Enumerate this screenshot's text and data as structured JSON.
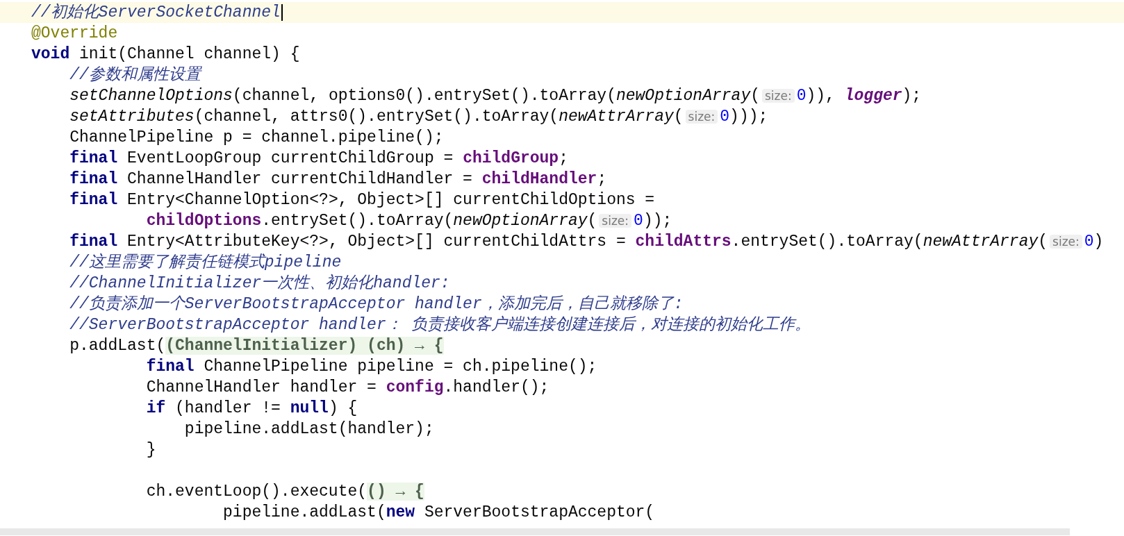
{
  "editor": {
    "lines": [
      {
        "current": true,
        "tokens": [
          {
            "kind": "comment",
            "text": "//初始化ServerSocketChannel"
          }
        ]
      },
      {
        "current": false,
        "tokens": [
          {
            "kind": "annotation",
            "text": "@Override"
          }
        ]
      },
      {
        "current": false,
        "tokens": [
          {
            "kind": "keyword",
            "text": "void"
          },
          {
            "kind": "plain",
            "text": " init(Channel channel) {"
          }
        ]
      },
      {
        "current": false,
        "tokens": [
          {
            "kind": "comment",
            "text": "    //参数和属性设置"
          }
        ]
      },
      {
        "current": false,
        "tokens": [
          {
            "kind": "italic",
            "text": "    setChannelOptions"
          },
          {
            "kind": "plain",
            "text": "(channel, options0().entrySet().toArray("
          },
          {
            "kind": "italic",
            "text": "newOptionArray"
          },
          {
            "kind": "plain",
            "text": "("
          },
          {
            "kind": "hint",
            "text": "size:"
          },
          {
            "kind": "number",
            "text": "0"
          },
          {
            "kind": "plain",
            "text": ")), "
          },
          {
            "kind": "field_italic",
            "text": "logger"
          },
          {
            "kind": "plain",
            "text": ");"
          }
        ]
      },
      {
        "current": false,
        "tokens": [
          {
            "kind": "italic",
            "text": "    setAttributes"
          },
          {
            "kind": "plain",
            "text": "(channel, attrs0().entrySet().toArray("
          },
          {
            "kind": "italic",
            "text": "newAttrArray"
          },
          {
            "kind": "plain",
            "text": "("
          },
          {
            "kind": "hint",
            "text": "size:"
          },
          {
            "kind": "number",
            "text": "0"
          },
          {
            "kind": "plain",
            "text": ")));"
          }
        ]
      },
      {
        "current": false,
        "tokens": [
          {
            "kind": "plain",
            "text": "    ChannelPipeline p = channel.pipeline();"
          }
        ]
      },
      {
        "current": false,
        "tokens": [
          {
            "kind": "keyword",
            "text": "    final"
          },
          {
            "kind": "plain",
            "text": " EventLoopGroup currentChildGroup = "
          },
          {
            "kind": "field",
            "text": "childGroup"
          },
          {
            "kind": "plain",
            "text": ";"
          }
        ]
      },
      {
        "current": false,
        "tokens": [
          {
            "kind": "keyword",
            "text": "    final"
          },
          {
            "kind": "plain",
            "text": " ChannelHandler currentChildHandler = "
          },
          {
            "kind": "field",
            "text": "childHandler"
          },
          {
            "kind": "plain",
            "text": ";"
          }
        ]
      },
      {
        "current": false,
        "tokens": [
          {
            "kind": "keyword",
            "text": "    final"
          },
          {
            "kind": "plain",
            "text": " Entry<ChannelOption<?>, Object>[] currentChildOptions ="
          }
        ]
      },
      {
        "current": false,
        "tokens": [
          {
            "kind": "field",
            "text": "            childOptions"
          },
          {
            "kind": "plain",
            "text": ".entrySet().toArray("
          },
          {
            "kind": "italic",
            "text": "newOptionArray"
          },
          {
            "kind": "plain",
            "text": "("
          },
          {
            "kind": "hint",
            "text": "size:"
          },
          {
            "kind": "number",
            "text": "0"
          },
          {
            "kind": "plain",
            "text": "));"
          }
        ]
      },
      {
        "current": false,
        "tokens": [
          {
            "kind": "keyword",
            "text": "    final"
          },
          {
            "kind": "plain",
            "text": " Entry<AttributeKey<?>, Object>[] currentChildAttrs = "
          },
          {
            "kind": "field",
            "text": "childAttrs"
          },
          {
            "kind": "plain",
            "text": ".entrySet().toArray("
          },
          {
            "kind": "italic",
            "text": "newAttrArray"
          },
          {
            "kind": "plain",
            "text": "("
          },
          {
            "kind": "hint",
            "text": "size:"
          },
          {
            "kind": "number",
            "text": "0"
          },
          {
            "kind": "plain",
            "text": ")"
          }
        ]
      },
      {
        "current": false,
        "tokens": [
          {
            "kind": "comment",
            "text": "    //这里需要了解责任链模式pipeline"
          }
        ]
      },
      {
        "current": false,
        "tokens": [
          {
            "kind": "comment",
            "text": "    //ChannelInitializer一次性、初始化handler:"
          }
        ]
      },
      {
        "current": false,
        "tokens": [
          {
            "kind": "comment",
            "text": "    //负责添加一个ServerBootstrapAcceptor handler，添加完后，自己就移除了:"
          }
        ]
      },
      {
        "current": false,
        "tokens": [
          {
            "kind": "comment",
            "text": "    //ServerBootstrapAcceptor handler： 负责接收客户端连接创建连接后，对连接的初始化工作。"
          }
        ]
      },
      {
        "current": false,
        "tokens": [
          {
            "kind": "plain",
            "text": "    p.addLast("
          },
          {
            "kind": "lambda",
            "text": "(ChannelInitializer) (ch) → {"
          }
        ]
      },
      {
        "current": false,
        "tokens": [
          {
            "kind": "keyword",
            "text": "            final"
          },
          {
            "kind": "plain",
            "text": " ChannelPipeline pipeline = ch.pipeline();"
          }
        ]
      },
      {
        "current": false,
        "tokens": [
          {
            "kind": "plain",
            "text": "            ChannelHandler handler = "
          },
          {
            "kind": "field",
            "text": "config"
          },
          {
            "kind": "plain",
            "text": ".handler();"
          }
        ]
      },
      {
        "current": false,
        "tokens": [
          {
            "kind": "keyword",
            "text": "            if"
          },
          {
            "kind": "plain",
            "text": " (handler != "
          },
          {
            "kind": "keyword",
            "text": "null"
          },
          {
            "kind": "plain",
            "text": ") {"
          }
        ]
      },
      {
        "current": false,
        "tokens": [
          {
            "kind": "plain",
            "text": "                pipeline.addLast(handler);"
          }
        ]
      },
      {
        "current": false,
        "tokens": [
          {
            "kind": "plain",
            "text": "            }"
          }
        ]
      },
      {
        "current": false,
        "gap_before": true,
        "tokens": [
          {
            "kind": "plain",
            "text": "            ch.eventLoop().execute("
          },
          {
            "kind": "lambda",
            "text": "() → {"
          }
        ]
      },
      {
        "current": false,
        "tokens": [
          {
            "kind": "plain",
            "text": "                    pipeline.addLast("
          },
          {
            "kind": "keyword",
            "text": "new"
          },
          {
            "kind": "plain",
            "text": " ServerBootstrapAcceptor("
          }
        ]
      }
    ]
  }
}
